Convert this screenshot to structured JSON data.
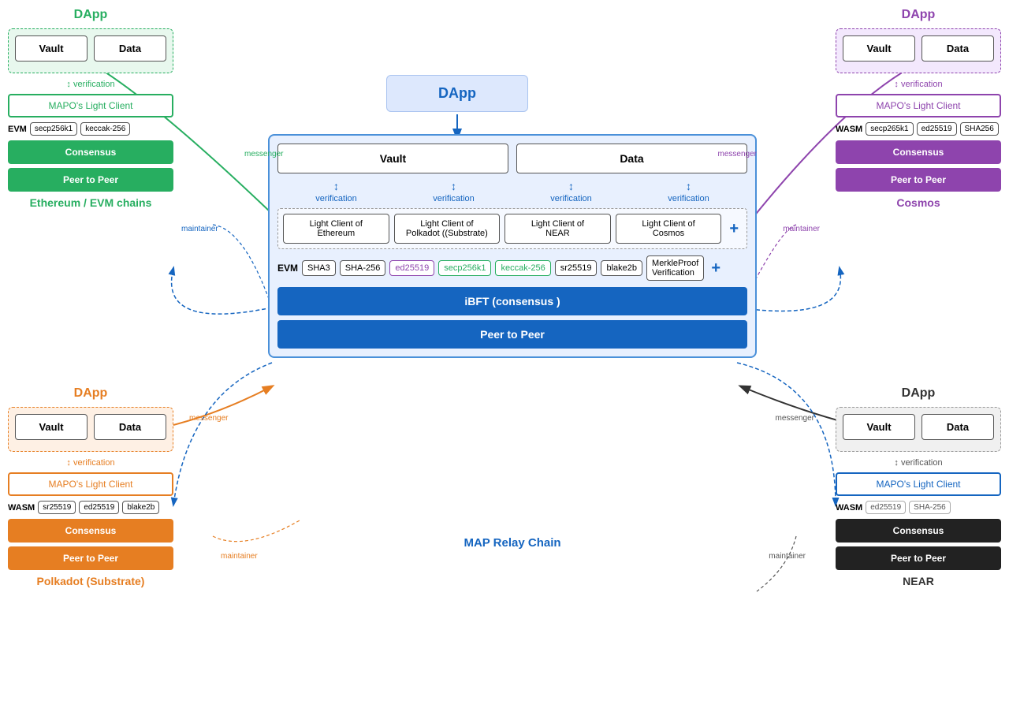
{
  "center": {
    "dapp_label": "DApp",
    "vault_label": "Vault",
    "data_label": "Data",
    "verification_label": "verification",
    "light_clients": [
      "Light Client of Ethereum",
      "Light Client of Polkadot ((Substrate)",
      "Light Client of NEAR",
      "Light Client of Cosmos"
    ],
    "evm_label": "EVM",
    "evm_tags": [
      "SHA3",
      "SHA-256",
      "ed25519",
      "secp256k1",
      "keccak-256",
      "sr25519",
      "blake2b",
      "MerkleProof Verification"
    ],
    "ibft_label": "iBFT (consensus )",
    "p2p_label": "Peer to Peer",
    "map_relay_label": "MAP Relay Chain",
    "plus_icon": "+"
  },
  "ethereum": {
    "dapp_label": "DApp",
    "vault_label": "Vault",
    "data_label": "Data",
    "verification_label": "verification",
    "light_client_label": "MAPO's Light Client",
    "evm_label": "EVM",
    "tags": [
      "secp256k1",
      "keccak-256"
    ],
    "consensus_label": "Consensus",
    "p2p_label": "Peer to Peer",
    "chain_label": "Ethereum / EVM chains",
    "messenger_label": "messenger",
    "maintainer_label": "maintainer"
  },
  "polkadot": {
    "dapp_label": "DApp",
    "vault_label": "Vault",
    "data_label": "Data",
    "verification_label": "verification",
    "light_client_label": "MAPO's Light Client",
    "wasm_label": "WASM",
    "tags": [
      "sr25519",
      "ed25519",
      "blake2b"
    ],
    "consensus_label": "Consensus",
    "p2p_label": "Peer to Peer",
    "chain_label": "Polkadot (Substrate)",
    "messenger_label": "messenger",
    "maintainer_label": "maintainer"
  },
  "cosmos": {
    "dapp_label": "DApp",
    "vault_label": "Vault",
    "data_label": "Data",
    "verification_label": "verification",
    "light_client_label": "MAPO's Light Client",
    "wasm_label": "WASM",
    "tags": [
      "secp265k1",
      "ed25519",
      "SHA256"
    ],
    "consensus_label": "Consensus",
    "p2p_label": "Peer to Peer",
    "chain_label": "Cosmos",
    "messenger_label": "messenger",
    "maintainer_label": "maintainer"
  },
  "near": {
    "dapp_label": "DApp",
    "vault_label": "Vault",
    "data_label": "Data",
    "verification_label": "verification",
    "light_client_label": "MAPO's Light Client",
    "wasm_label": "WASM",
    "tags": [
      "ed25519",
      "SHA-256"
    ],
    "consensus_label": "Consensus",
    "p2p_label": "Peer to Peer",
    "chain_label": "NEAR",
    "messenger_label": "messenger",
    "maintainer_label": "maintainer"
  }
}
